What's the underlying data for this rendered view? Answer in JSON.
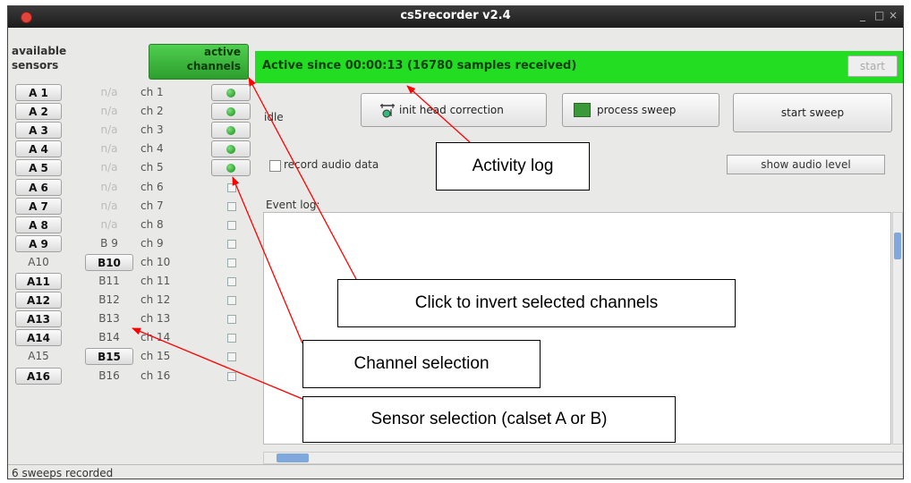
{
  "window": {
    "title": "cs5recorder v2.4",
    "controls": [
      "_",
      "□",
      "×"
    ]
  },
  "sidebar": {
    "available_header": [
      "available",
      "sensors"
    ],
    "active_header": [
      "active",
      "channels"
    ],
    "rows": [
      {
        "a": "A 1",
        "b": "n/a",
        "ch": "ch 1",
        "active": true,
        "sel": "a"
      },
      {
        "a": "A 2",
        "b": "n/a",
        "ch": "ch 2",
        "active": true,
        "sel": "a"
      },
      {
        "a": "A 3",
        "b": "n/a",
        "ch": "ch 3",
        "active": true,
        "sel": "a"
      },
      {
        "a": "A 4",
        "b": "n/a",
        "ch": "ch 4",
        "active": true,
        "sel": "a"
      },
      {
        "a": "A 5",
        "b": "n/a",
        "ch": "ch 5",
        "active": true,
        "sel": "a"
      },
      {
        "a": "A 6",
        "b": "n/a",
        "ch": "ch 6",
        "active": false,
        "sel": "a"
      },
      {
        "a": "A 7",
        "b": "n/a",
        "ch": "ch 7",
        "active": false,
        "sel": "a"
      },
      {
        "a": "A 8",
        "b": "n/a",
        "ch": "ch 8",
        "active": false,
        "sel": "a"
      },
      {
        "a": "A 9",
        "b": "B 9",
        "ch": "ch 9",
        "active": false,
        "sel": "a"
      },
      {
        "a": "A10",
        "b": "B10",
        "ch": "ch 10",
        "active": false,
        "sel": "b"
      },
      {
        "a": "A11",
        "b": "B11",
        "ch": "ch 11",
        "active": false,
        "sel": "a"
      },
      {
        "a": "A12",
        "b": "B12",
        "ch": "ch 12",
        "active": false,
        "sel": "a"
      },
      {
        "a": "A13",
        "b": "B13",
        "ch": "ch 13",
        "active": false,
        "sel": "a"
      },
      {
        "a": "A14",
        "b": "B14",
        "ch": "ch 14",
        "active": false,
        "sel": "a"
      },
      {
        "a": "A15",
        "b": "B15",
        "ch": "ch 15",
        "active": false,
        "sel": "b"
      },
      {
        "a": "A16",
        "b": "B16",
        "ch": "ch 16",
        "active": false,
        "sel": "a"
      }
    ]
  },
  "main": {
    "status_banner": "Active since 00:00:13 (16780 samples received)",
    "start_label": "start",
    "state_label": "idle",
    "init_head_label": "init head correction",
    "process_sweep_label": "process sweep",
    "start_sweep_label": "start sweep",
    "record_audio_label": "record audio data",
    "record_audio_checked": false,
    "show_audio_label": "show audio level",
    "event_log_label": "Event log:"
  },
  "statusbar": {
    "text": "6 sweeps recorded"
  },
  "annotations": {
    "activity_log": "Activity log",
    "invert_channels": "Click to invert selected channels",
    "channel_selection": "Channel selection",
    "sensor_selection": "Sensor selection (calset A or B)"
  },
  "colors": {
    "active_green": "#22dd22",
    "annotation_arrow": "#ff0000"
  }
}
